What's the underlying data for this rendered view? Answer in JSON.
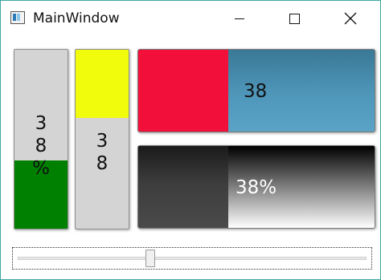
{
  "window": {
    "title": "MainWindow",
    "icon": "app-window-icon",
    "border_color": "#3ea7a0"
  },
  "caption_buttons": {
    "minimize_icon": "minimize-icon",
    "maximize_icon": "maximize-icon",
    "close_icon": "close-icon",
    "close_glyph": "✕"
  },
  "progress": {
    "value": 38,
    "fraction": 0.38,
    "vertical_1": {
      "lines": [
        "3",
        "8",
        "%"
      ],
      "fill_color": "#008000",
      "track_color": "#d4d4d4"
    },
    "vertical_2": {
      "lines": [
        "3",
        "8"
      ],
      "fill_color": "#f1fb0c",
      "track_color": "#d4d4d4"
    },
    "horizontal_1": {
      "label": "38",
      "fill_color": "#f20f3a",
      "track_color": "#4f97ba"
    },
    "horizontal_2": {
      "label": "38%",
      "fill_color": "#3d3d3d",
      "track_gradient": [
        "#000000",
        "#ffffff"
      ]
    }
  },
  "slider": {
    "value_fraction": 0.38
  }
}
